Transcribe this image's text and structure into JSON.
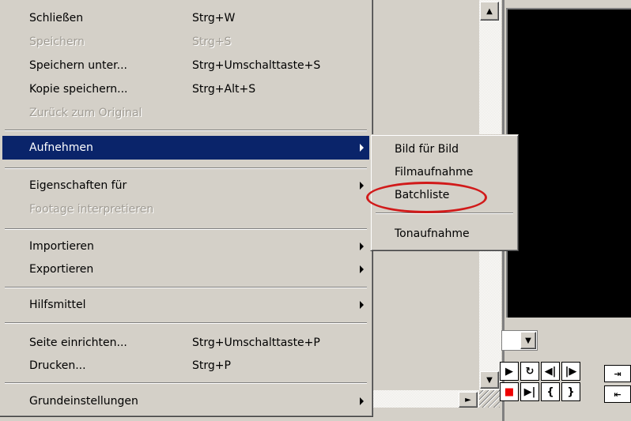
{
  "menu": {
    "items": [
      {
        "label": "Schließen",
        "shortcut": "Strg+W",
        "disabled": false
      },
      {
        "label": "Speichern",
        "shortcut": "Strg+S",
        "disabled": true
      },
      {
        "label": "Speichern unter...",
        "shortcut": "Strg+Umschalttaste+S",
        "disabled": false
      },
      {
        "label": "Kopie speichern...",
        "shortcut": "Strg+Alt+S",
        "disabled": false
      },
      {
        "label": "Zurück zum Original",
        "shortcut": "",
        "disabled": true
      },
      {
        "label": "Aufnehmen",
        "shortcut": "",
        "submenu": true,
        "selected": true
      },
      {
        "label": "Eigenschaften für",
        "shortcut": "",
        "submenu": true
      },
      {
        "label": "Footage interpretieren",
        "shortcut": "",
        "disabled": true
      },
      {
        "label": "Importieren",
        "shortcut": "",
        "submenu": true
      },
      {
        "label": "Exportieren",
        "shortcut": "",
        "submenu": true
      },
      {
        "label": "Hilfsmittel",
        "shortcut": "",
        "submenu": true
      },
      {
        "label": "Seite einrichten...",
        "shortcut": "Strg+Umschalttaste+P",
        "disabled": false
      },
      {
        "label": "Drucken...",
        "shortcut": "Strg+P",
        "disabled": false
      },
      {
        "label": "Grundeinstellungen",
        "shortcut": "",
        "submenu": true
      }
    ]
  },
  "submenu": {
    "parent": "Aufnehmen",
    "items": [
      {
        "label": "Bild für Bild"
      },
      {
        "label": "Filmaufnahme"
      },
      {
        "label": "Batchliste",
        "highlighted": true
      },
      {
        "label": "Tonaufnahme"
      }
    ]
  },
  "colors": {
    "selection_bg": "#0a246a",
    "highlight_ring": "#d11a1a",
    "disabled_text": "#a09c94"
  }
}
